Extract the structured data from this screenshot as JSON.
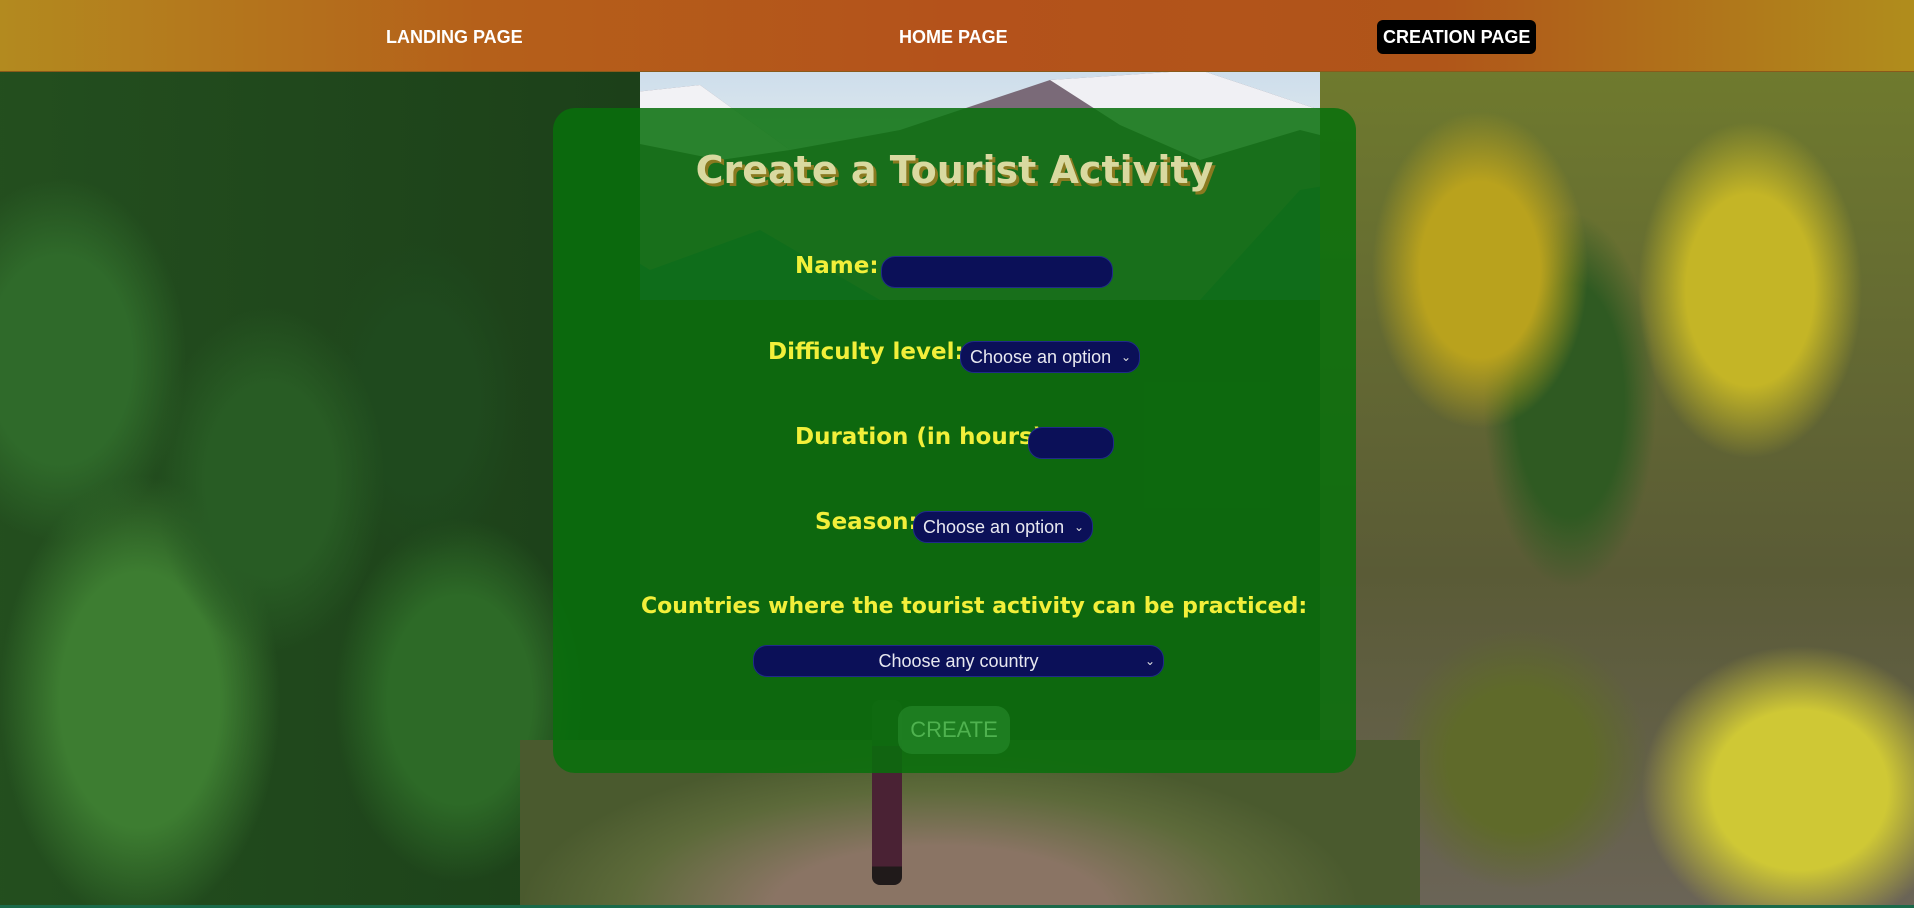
{
  "nav": {
    "landing_label": "LANDING PAGE",
    "home_label": "HOME PAGE",
    "creation_label": "CREATION PAGE"
  },
  "form": {
    "title": "Create a Tourist Activity",
    "name_label": "Name:",
    "name_value": "",
    "difficulty_label": "Difficulty level:",
    "difficulty_value": "Choose an option",
    "duration_label": "Duration (in hours):",
    "duration_value": "",
    "season_label": "Season:",
    "season_value": "Choose an option",
    "countries_label": "Countries where the tourist activity can be practiced:",
    "countries_value": "Choose any country",
    "create_label": "CREATE"
  },
  "colors": {
    "nav_gradient_start": "#b38a1f",
    "nav_gradient_mid": "#b4521b",
    "active_tab_bg": "#000000",
    "card_bg": "#08700c",
    "label_color": "#f2ef3a",
    "field_bg": "#0b1058",
    "title_color": "#d9d9a0"
  },
  "icons": {
    "select_chevron": "chevron-down-icon"
  }
}
